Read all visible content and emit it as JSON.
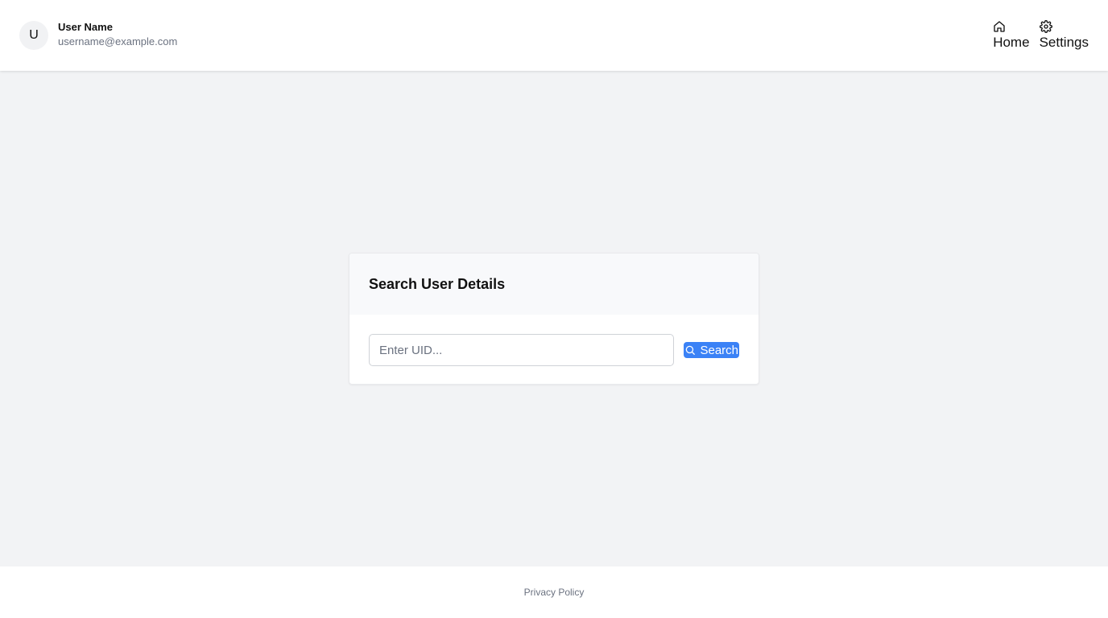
{
  "header": {
    "avatar_initial": "U",
    "user_name": "User Name",
    "user_email": "username@example.com",
    "nav": [
      {
        "label": "Home",
        "icon": "home-icon"
      },
      {
        "label": "Settings",
        "icon": "gear-icon"
      }
    ]
  },
  "search_card": {
    "title": "Search User Details",
    "input_placeholder": "Enter UID...",
    "input_value": "",
    "button_label": "Search",
    "button_icon": "search-icon"
  },
  "footer": {
    "privacy_link": "Privacy Policy"
  },
  "colors": {
    "accent": "#3b82f6",
    "page_background": "#f2f3f5",
    "muted_text": "#6b7280"
  }
}
